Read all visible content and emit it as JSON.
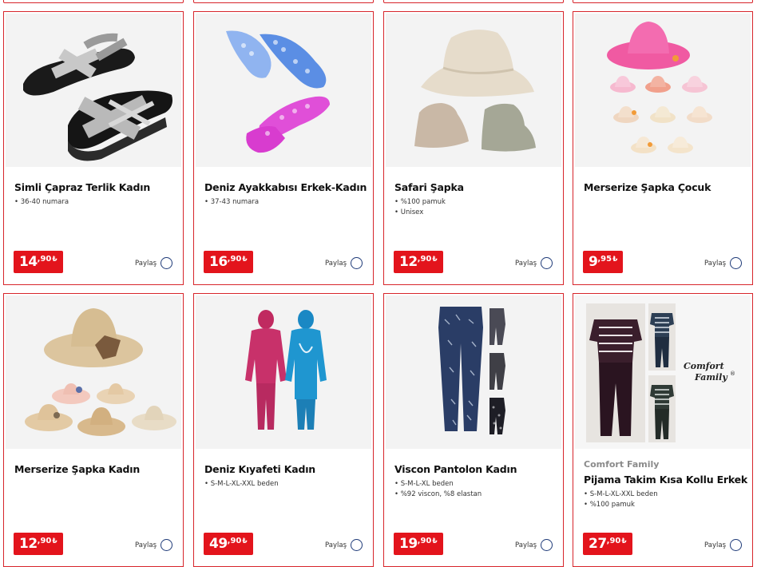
{
  "currency_symbol": "₺",
  "share_label": "Paylaş",
  "colors": {
    "accent": "#d7252b",
    "price_bg": "#e3141c",
    "share_circle": "#1e3a78"
  },
  "products": [
    {
      "title": "Simli Çapraz Terlik Kadın",
      "features": [
        "36-40 numara"
      ],
      "price_int": "14",
      "price_dec": ",90",
      "image": "sandals"
    },
    {
      "title": "Deniz Ayakkabısı Erkek-Kadın",
      "features": [
        "37-43 numara"
      ],
      "price_int": "16",
      "price_dec": ",90",
      "image": "water-shoes"
    },
    {
      "title": "Safari Şapka",
      "features": [
        "%100 pamuk",
        "Unisex"
      ],
      "price_int": "12",
      "price_dec": ",90",
      "image": "bucket-hats"
    },
    {
      "title": "Merserize Şapka Çocuk",
      "features": [],
      "price_int": "9",
      "price_dec": ",95",
      "image": "kids-hats"
    },
    {
      "title": "Merserize Şapka Kadın",
      "features": [],
      "price_int": "12",
      "price_dec": ",90",
      "image": "women-hats"
    },
    {
      "title": "Deniz Kıyafeti Kadın",
      "features": [
        "S-M-L-XL-XXL beden"
      ],
      "price_int": "49",
      "price_dec": ",90",
      "image": "swimsuits"
    },
    {
      "title": "Viscon Pantolon Kadın",
      "features": [
        "S-M-L-XL beden",
        "%92 viscon, %8 elastan"
      ],
      "price_int": "19",
      "price_dec": ",90",
      "image": "pants"
    },
    {
      "brand": "Comfort Family",
      "title": "Pijama Takim Kısa Kollu Erkek",
      "features": [
        "S-M-L-XL-XXL beden",
        "%100 pamuk"
      ],
      "price_int": "27",
      "price_dec": ",90",
      "image": "pajamas",
      "image_logo": [
        "Comfort",
        "Family"
      ]
    }
  ]
}
